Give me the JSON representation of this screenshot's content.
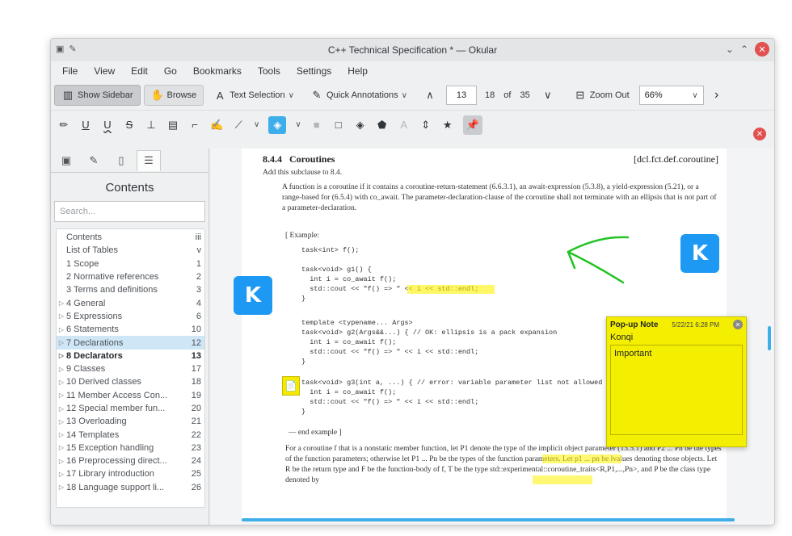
{
  "window": {
    "title": "C++ Technical Specification * — Okular"
  },
  "menu": [
    "File",
    "View",
    "Edit",
    "Go",
    "Bookmarks",
    "Tools",
    "Settings",
    "Help"
  ],
  "toolbar": {
    "show_sidebar": "Show Sidebar",
    "browse": "Browse",
    "text_selection": "Text Selection",
    "quick_annotations": "Quick Annotations",
    "page_current": "13",
    "page_total_label": "18 of 35",
    "zoom_out": "Zoom Out",
    "zoom_value": "66%"
  },
  "sidebar": {
    "title": "Contents",
    "search_placeholder": "Search...",
    "toc": [
      {
        "label": "Contents",
        "page": "iii"
      },
      {
        "label": "List of Tables",
        "page": "v"
      },
      {
        "label": "1 Scope",
        "page": "1"
      },
      {
        "label": "2 Normative references",
        "page": "2"
      },
      {
        "label": "3 Terms and definitions",
        "page": "3"
      },
      {
        "label": "4 General",
        "page": "4"
      },
      {
        "label": "5 Expressions",
        "page": "6"
      },
      {
        "label": "6 Statements",
        "page": "10"
      },
      {
        "label": "7 Declarations",
        "page": "12"
      },
      {
        "label": "8 Declarators",
        "page": "13"
      },
      {
        "label": "9 Classes",
        "page": "17"
      },
      {
        "label": "10 Derived classes",
        "page": "18"
      },
      {
        "label": "11 Member Access Con...",
        "page": "19"
      },
      {
        "label": "12 Special member fun...",
        "page": "20"
      },
      {
        "label": "13 Overloading",
        "page": "21"
      },
      {
        "label": "14 Templates",
        "page": "22"
      },
      {
        "label": "15 Exception handling",
        "page": "23"
      },
      {
        "label": "16 Preprocessing direct...",
        "page": "24"
      },
      {
        "label": "17 Library introduction",
        "page": "25"
      },
      {
        "label": "18 Language support li...",
        "page": "26"
      }
    ]
  },
  "document": {
    "section_number": "8.4.4",
    "section_title": "Coroutines",
    "section_ref": "[dcl.fct.def.coroutine]",
    "intro": "Add this subclause to 8.4.",
    "para1": "A function is a coroutine if it contains a coroutine-return-statement (6.6.3.1), an await-expression (5.3.8), a yield-expression (5.21), or a range-based for (6.5.4) with co_await. The parameter-declaration-clause of the coroutine shall not terminate with an ellipsis that is not part of a parameter-declaration.",
    "example_label": "[ Example:",
    "code1": "task<int> f();",
    "code2": "task<void> g1() {\n  int i = co_await f();\n  std::cout << \"f() => \" << i << std::endl;\n}",
    "code3": "template <typename... Args>\ntask<void> g2(Args&&...) { // OK: ellipsis is a pack expansion\n  int i = co_await f();\n  std::cout << \"f() => \" << i << std::endl;\n}",
    "code4": "task<void> g3(int a, ...) { // error: variable parameter list not allowed\n  int i = co_await f();\n  std::cout << \"f() => \" << i << std::endl;\n}",
    "end_example": "— end example ]",
    "para2": "For a coroutine f that is a nonstatic member function, let P1 denote the type of the implicit object parameter (13.3.1) and P2 ... Pn be the types of the function parameters; otherwise let P1 ... Pn be the types of the function parameters. Let p1 ... pn be lvalues denoting those objects. Let R be the return type and F be the function-body of f, T be the type std::experimental::coroutine_traits<R,P1,...,Pn>, and P be the class type denoted by"
  },
  "popup_note": {
    "title": "Pop-up Note",
    "date": "5/22/21 6:28 PM",
    "author": "Konqi",
    "text": "Important"
  },
  "colors": {
    "accent": "#3daee9",
    "highlight": "#fff200",
    "kde_blue": "#1d99f3",
    "close_red": "#e0514f",
    "note_yellow": "#f4ee00",
    "arrow_green": "#22c322"
  }
}
